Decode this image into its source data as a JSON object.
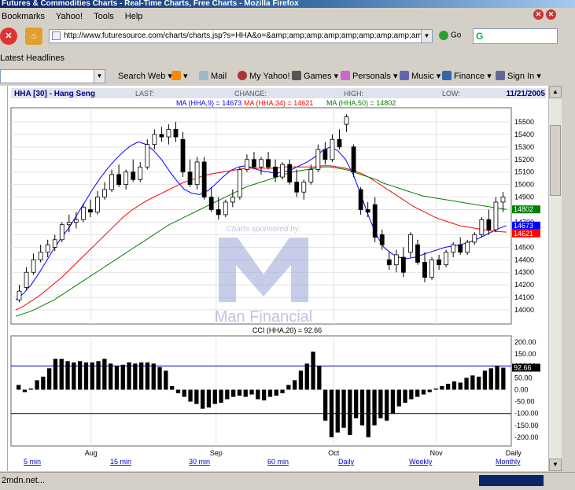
{
  "window": {
    "title": "Futures & Commodities Charts - Real-Time Charts, Free Charts - Mozilla Firefox"
  },
  "menu": {
    "items": [
      "Bookmarks",
      "Yahoo!",
      "Tools",
      "Help"
    ]
  },
  "nav": {
    "url": "http://www.futuresource.com/charts/charts.jsp?s=HHA&o=&amp;amp;amp;amp;amp;amp;amp;amp;amp;a=",
    "go_label": "Go",
    "search_logo": "G"
  },
  "headlines": {
    "label": "Latest Headlines"
  },
  "toolbar": {
    "search_web": "Search Web",
    "mail": "Mail",
    "my_yahoo": "My Yahoo!",
    "games": "Games",
    "personals": "Personals",
    "music": "Music",
    "finance": "Finance",
    "sign_in": "Sign In"
  },
  "chart_header": {
    "symbol": "HHA [30] - Hang Seng",
    "last": "LAST:",
    "change": "CHANGE:",
    "high": "HIGH:",
    "low": "LOW:",
    "date": "11/21/2005"
  },
  "ma_legend": {
    "ma9": "MA (HHA,9) = 14673",
    "ma34": "MA (HHA,34) = 14621",
    "ma50": "MA (HHA,50) = 14802"
  },
  "cci_legend": "CCI (HHA,20) = 92.66",
  "watermark": {
    "sponsor": "Charts sponsored by:",
    "name": "Man Financial"
  },
  "bottom_tabs": [
    "5 min",
    "15 min",
    "30 min",
    "60 min",
    "Daily",
    "Weekly",
    "Monthly"
  ],
  "status": {
    "text": "2mdn.net..."
  },
  "colors": {
    "ma9": "#0000ff",
    "ma34": "#ff0000",
    "ma50": "#008000",
    "candle": "#000000"
  },
  "chart_data": [
    {
      "type": "candlestick",
      "title": "HHA [30] - Hang Seng",
      "ylim": [
        13900,
        15600
      ],
      "y_ticks": [
        14000,
        14100,
        14200,
        14300,
        14400,
        14500,
        14600,
        14700,
        14800,
        14900,
        15000,
        15100,
        15200,
        15300,
        15400,
        15500
      ],
      "x_labels": [
        "Aug",
        "Sep",
        "Oct",
        "Nov",
        "Daily"
      ],
      "last_values": {
        "ma50": "14802",
        "ma9": "14673",
        "ma34": "14621"
      },
      "series": [
        {
          "name": "MA (HHA,9)",
          "values": [
            14080,
            14130,
            14200,
            14290,
            14390,
            14490,
            14580,
            14660,
            14760,
            14860,
            14960,
            15050,
            15130,
            15200,
            15260,
            15310,
            15340,
            15320,
            15270,
            15200,
            15110,
            15030,
            14960,
            14930,
            14920,
            14950,
            15000,
            15060,
            15110,
            15140,
            15150,
            15130,
            15110,
            15100,
            15090,
            15100,
            15120,
            15150,
            15180,
            15220,
            15270,
            15300,
            15270,
            15200,
            15080,
            14920,
            14750,
            14600,
            14500,
            14450,
            14420,
            14410,
            14420,
            14440,
            14460,
            14480,
            14500,
            14510,
            14520,
            14540,
            14560,
            14590,
            14620,
            14650,
            14673
          ]
        },
        {
          "name": "MA (HHA,34)",
          "values": [
            14000,
            14030,
            14070,
            14110,
            14160,
            14210,
            14260,
            14320,
            14380,
            14440,
            14500,
            14560,
            14620,
            14680,
            14740,
            14790,
            14830,
            14870,
            14900,
            14930,
            14960,
            14990,
            15020,
            15040,
            15060,
            15080,
            15090,
            15100,
            15110,
            15120,
            15130,
            15130,
            15130,
            15130,
            15130,
            15140,
            15140,
            15140,
            15140,
            15140,
            15150,
            15150,
            15140,
            15130,
            15110,
            15090,
            15060,
            15020,
            14980,
            14940,
            14900,
            14860,
            14820,
            14790,
            14760,
            14730,
            14710,
            14690,
            14670,
            14660,
            14650,
            14640,
            14630,
            14625,
            14621
          ]
        },
        {
          "name": "MA (HHA,50)",
          "values": [
            13950,
            13970,
            13990,
            14020,
            14050,
            14080,
            14120,
            14160,
            14200,
            14240,
            14280,
            14320,
            14360,
            14400,
            14440,
            14480,
            14520,
            14560,
            14600,
            14640,
            14680,
            14710,
            14740,
            14770,
            14800,
            14830,
            14860,
            14890,
            14920,
            14950,
            14980,
            15000,
            15020,
            15040,
            15060,
            15080,
            15100,
            15110,
            15120,
            15130,
            15140,
            15140,
            15130,
            15120,
            15100,
            15080,
            15060,
            15040,
            15010,
            14990,
            14970,
            14950,
            14930,
            14910,
            14900,
            14890,
            14880,
            14870,
            14860,
            14850,
            14840,
            14830,
            14820,
            14810,
            14802
          ]
        },
        {
          "name": "OHLC",
          "values": [
            [
              14080,
              14200,
              14060,
              14150
            ],
            [
              14180,
              14340,
              14160,
              14300
            ],
            [
              14300,
              14450,
              14280,
              14400
            ],
            [
              14400,
              14520,
              14380,
              14460
            ],
            [
              14460,
              14560,
              14420,
              14520
            ],
            [
              14500,
              14600,
              14470,
              14560
            ],
            [
              14560,
              14700,
              14540,
              14680
            ],
            [
              14680,
              14760,
              14620,
              14700
            ],
            [
              14700,
              14780,
              14650,
              14720
            ],
            [
              14720,
              14850,
              14700,
              14820
            ],
            [
              14800,
              14880,
              14740,
              14780
            ],
            [
              14780,
              14950,
              14760,
              14900
            ],
            [
              14900,
              15020,
              14880,
              14960
            ],
            [
              14960,
              15120,
              14940,
              15080
            ],
            [
              15080,
              15160,
              14980,
              15000
            ],
            [
              15000,
              15120,
              14960,
              15100
            ],
            [
              15100,
              15200,
              15020,
              15040
            ],
            [
              15040,
              15180,
              15020,
              15140
            ],
            [
              15140,
              15360,
              15120,
              15320
            ],
            [
              15320,
              15440,
              15280,
              15400
            ],
            [
              15400,
              15460,
              15340,
              15380
            ],
            [
              15380,
              15480,
              15320,
              15440
            ],
            [
              15440,
              15500,
              15340,
              15380
            ],
            [
              15360,
              15420,
              15060,
              15100
            ],
            [
              15100,
              15200,
              14980,
              15000
            ],
            [
              15000,
              15220,
              14960,
              15180
            ],
            [
              15180,
              15220,
              14880,
              14900
            ],
            [
              14900,
              14980,
              14780,
              14800
            ],
            [
              14800,
              14900,
              14720,
              14760
            ],
            [
              14760,
              14880,
              14740,
              14860
            ],
            [
              14860,
              14960,
              14820,
              14900
            ],
            [
              14900,
              15140,
              14880,
              15120
            ],
            [
              15120,
              15240,
              15100,
              15200
            ],
            [
              15200,
              15260,
              15120,
              15140
            ],
            [
              15140,
              15220,
              15080,
              15200
            ],
            [
              15200,
              15260,
              15120,
              15140
            ],
            [
              15140,
              15200,
              15020,
              15060
            ],
            [
              15060,
              15180,
              15040,
              15160
            ],
            [
              15160,
              15200,
              15000,
              15020
            ],
            [
              15020,
              15120,
              14900,
              14940
            ],
            [
              14940,
              15040,
              14880,
              15020
            ],
            [
              15020,
              15160,
              15000,
              15120
            ],
            [
              15120,
              15320,
              15100,
              15280
            ],
            [
              15280,
              15340,
              15160,
              15200
            ],
            [
              15200,
              15400,
              15180,
              15360
            ],
            [
              15360,
              15440,
              15280,
              15300
            ],
            [
              15480,
              15560,
              15420,
              15540
            ],
            [
              15300,
              15320,
              15060,
              15100
            ],
            [
              14960,
              14980,
              14760,
              14800
            ],
            [
              14800,
              14860,
              14740,
              14780
            ],
            [
              14840,
              14900,
              14540,
              14580
            ],
            [
              14600,
              14640,
              14480,
              14520
            ],
            [
              14400,
              14460,
              14320,
              14360
            ],
            [
              14360,
              14480,
              14300,
              14440
            ],
            [
              14420,
              14500,
              14260,
              14300
            ],
            [
              14460,
              14620,
              14420,
              14600
            ],
            [
              14520,
              14560,
              14360,
              14380
            ],
            [
              14380,
              14460,
              14220,
              14260
            ],
            [
              14260,
              14420,
              14240,
              14400
            ],
            [
              14400,
              14440,
              14320,
              14360
            ],
            [
              14360,
              14480,
              14340,
              14460
            ],
            [
              14460,
              14540,
              14420,
              14520
            ],
            [
              14520,
              14580,
              14440,
              14460
            ],
            [
              14460,
              14560,
              14440,
              14540
            ],
            [
              14540,
              14620,
              14520,
              14600
            ],
            [
              14600,
              14740,
              14580,
              14720
            ],
            [
              14720,
              14800,
              14600,
              14640
            ],
            [
              14640,
              14900,
              14620,
              14860
            ],
            [
              14860,
              14940,
              14780,
              14900
            ]
          ]
        }
      ]
    },
    {
      "type": "bar",
      "title": "CCI (HHA,20) = 92.66",
      "ylim": [
        -230,
        220
      ],
      "y_ticks": [
        200,
        150,
        100,
        50,
        0,
        -50,
        -100,
        -150,
        -200
      ],
      "reference_lines": [
        100,
        -100
      ],
      "last_value": "92.66",
      "values": [
        20,
        -10,
        5,
        40,
        55,
        90,
        130,
        130,
        120,
        115,
        120,
        115,
        115,
        120,
        130,
        110,
        100,
        105,
        115,
        110,
        115,
        115,
        110,
        95,
        80,
        15,
        -15,
        -30,
        -50,
        -60,
        -80,
        -75,
        -60,
        -55,
        -40,
        -30,
        -25,
        -30,
        -20,
        -40,
        -45,
        -30,
        -25,
        -15,
        20,
        40,
        80,
        110,
        160,
        100,
        -130,
        -200,
        -180,
        -160,
        -190,
        -120,
        -150,
        -200,
        -150,
        -120,
        -130,
        -100,
        -70,
        -55,
        -40,
        -30,
        -20,
        -10,
        5,
        15,
        25,
        35,
        30,
        50,
        60,
        55,
        80,
        90,
        100,
        92.66
      ]
    }
  ]
}
